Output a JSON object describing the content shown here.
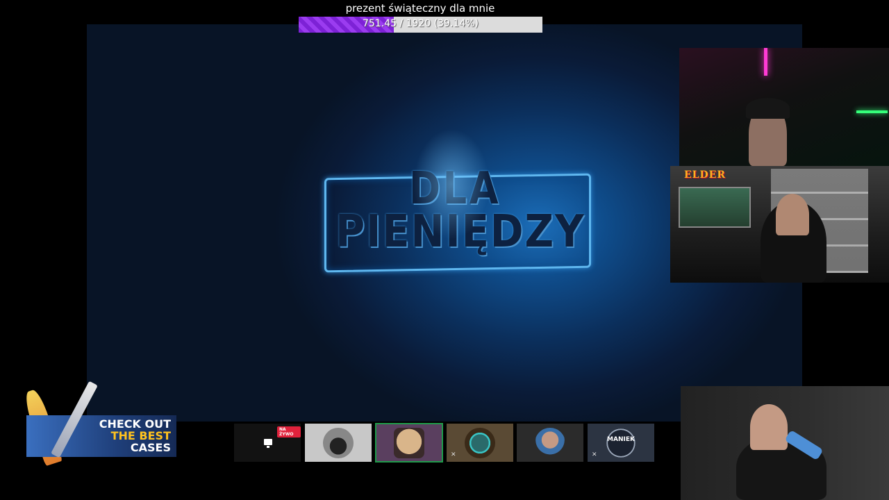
{
  "goal": {
    "title": "prezent świąteczny dla mnie",
    "current": "751.45",
    "rest": " / 1920 (39.14%)",
    "progress_fraction": 0.3914
  },
  "main_video": {
    "logo_line1": "DLA",
    "logo_line2": "PIENIĘDZY"
  },
  "overlay_ad": {
    "line1": "CHECK OUT",
    "line2": "THE BEST",
    "line3": "CASES"
  },
  "cam2": {
    "brand": "ELDER"
  },
  "participants": [
    {
      "name": "screen-share",
      "badge": "NA ŻYWO",
      "bg": "#121212"
    },
    {
      "name": "car-avatar",
      "bg": "#c8c8c8"
    },
    {
      "name": "face-avatar",
      "bg": "#5a3f5f",
      "selected": true
    },
    {
      "name": "character-avatar",
      "bg": "#5a4a34",
      "muted": true
    },
    {
      "name": "person-avatar",
      "bg": "#2b2b2b"
    },
    {
      "name": "maniek-avatar",
      "label": "MANIEK",
      "bg": "#2c3442",
      "muted": true
    }
  ],
  "colors": {
    "goal_fill": "#8a2be2",
    "live_badge": "#e0223c",
    "selected_outline": "#1f9a4a"
  }
}
